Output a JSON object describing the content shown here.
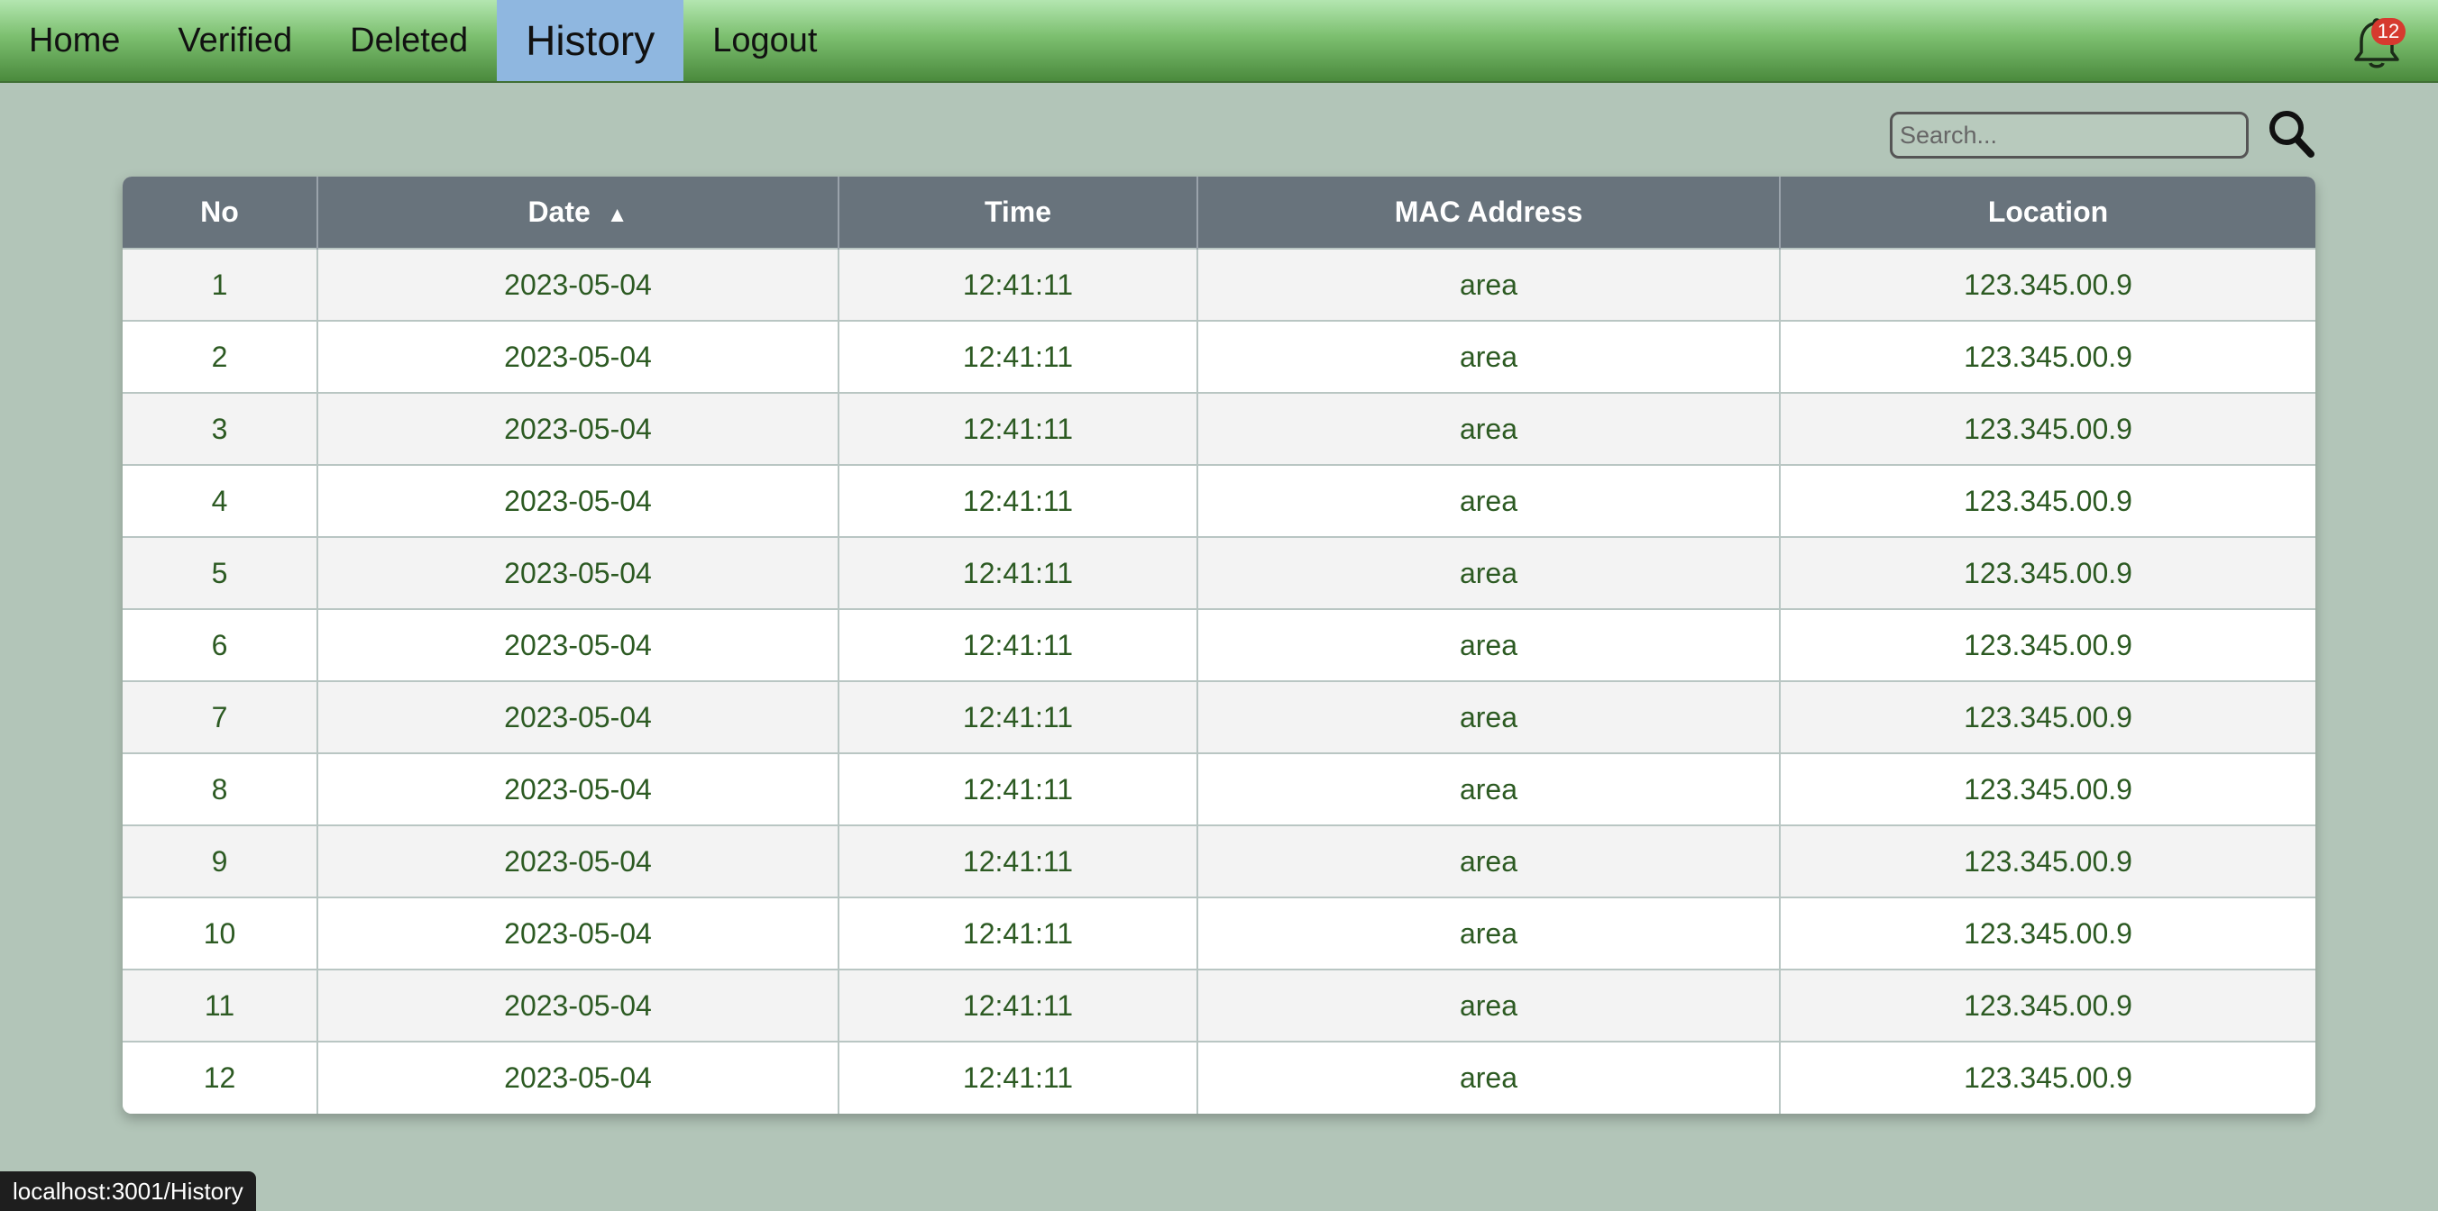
{
  "nav": {
    "items": [
      "Home",
      "Verified",
      "Deleted",
      "History",
      "Logout"
    ],
    "active": "History"
  },
  "notifications": {
    "count": "12",
    "icon": "bell-icon"
  },
  "search": {
    "placeholder": "Search...",
    "value": "",
    "icon": "search-icon"
  },
  "table": {
    "columns": [
      "No",
      "Date",
      "Time",
      "MAC Address",
      "Location"
    ],
    "sort_indicator": "▲",
    "rows": [
      [
        "1",
        "2023-05-04",
        "12:41:11",
        "area",
        "123.345.00.9"
      ],
      [
        "2",
        "2023-05-04",
        "12:41:11",
        "area",
        "123.345.00.9"
      ],
      [
        "3",
        "2023-05-04",
        "12:41:11",
        "area",
        "123.345.00.9"
      ],
      [
        "4",
        "2023-05-04",
        "12:41:11",
        "area",
        "123.345.00.9"
      ],
      [
        "5",
        "2023-05-04",
        "12:41:11",
        "area",
        "123.345.00.9"
      ],
      [
        "6",
        "2023-05-04",
        "12:41:11",
        "area",
        "123.345.00.9"
      ],
      [
        "7",
        "2023-05-04",
        "12:41:11",
        "area",
        "123.345.00.9"
      ],
      [
        "8",
        "2023-05-04",
        "12:41:11",
        "area",
        "123.345.00.9"
      ],
      [
        "9",
        "2023-05-04",
        "12:41:11",
        "area",
        "123.345.00.9"
      ],
      [
        "10",
        "2023-05-04",
        "12:41:11",
        "area",
        "123.345.00.9"
      ],
      [
        "11",
        "2023-05-04",
        "12:41:11",
        "area",
        "123.345.00.9"
      ],
      [
        "12",
        "2023-05-04",
        "12:41:11",
        "area",
        "123.345.00.9"
      ]
    ]
  },
  "status_bar": {
    "url": "localhost:3001/History"
  },
  "colors": {
    "page_bg": "#b2c5b8",
    "nav_active": "#8fb7e0",
    "header_bg": "#68737c",
    "cell_text": "#2c5a22",
    "badge": "#d63a2f"
  }
}
